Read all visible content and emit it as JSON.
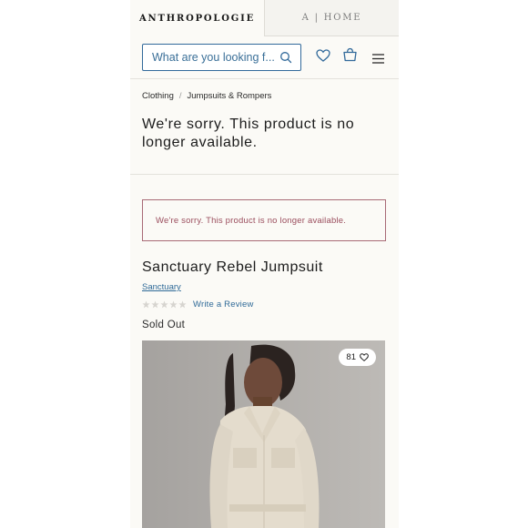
{
  "brand_tabs": {
    "primary": "ANTHROPOLOGIE",
    "secondary": "A | HOME"
  },
  "search": {
    "placeholder": "What are you looking f..."
  },
  "icons": {
    "search": "search-icon",
    "wishlist": "heart-icon",
    "bag": "shopping-bag-icon",
    "menu": "hamburger-menu-icon"
  },
  "breadcrumb": {
    "items": [
      "Clothing",
      "Jumpsuits & Rompers"
    ],
    "separator": "/"
  },
  "notice": {
    "title": "We're sorry. This product is no longer available.",
    "alert_text": "We're sorry. This product is no longer available."
  },
  "product": {
    "name": "Sanctuary Rebel Jumpsuit",
    "brand": "Sanctuary",
    "rating_stars": 0,
    "rating_max": 5,
    "review_link": "Write a Review",
    "stock_status": "Sold Out",
    "favorite_count": "81"
  },
  "colors": {
    "accent_blue": "#31699a",
    "alert_rose": "#9b4e5e",
    "page_bg": "#fbfaf6"
  }
}
